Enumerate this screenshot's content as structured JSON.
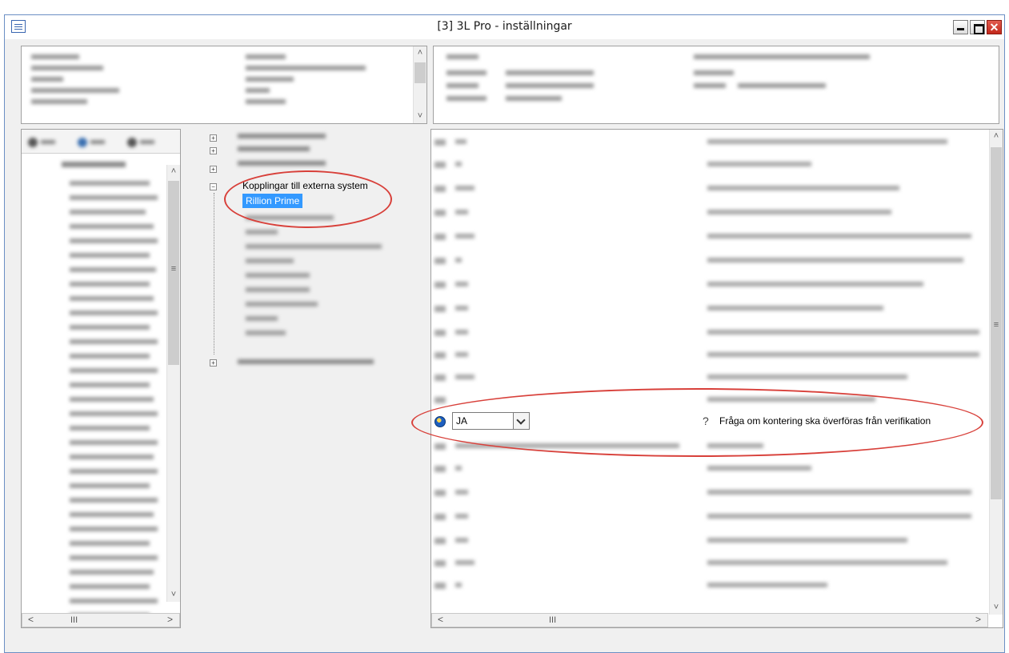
{
  "window": {
    "title": "[3]  3L Pro - inställningar",
    "close_glyph": "✕"
  },
  "middle_tree": {
    "expanded_node": "Kopplingar till externa system",
    "selected_child": "Rillion Prime"
  },
  "settings_grid": {
    "highlighted_row": {
      "value": "JA",
      "label": "Fråga om kontering ska överföras från verifikation"
    }
  },
  "scrollbars": {
    "up_arrow": "˄",
    "down_arrow": "˅",
    "left_arrow": "<",
    "right_arrow": ">",
    "grip_horizontal": "III",
    "grip_vertical": "≡"
  },
  "tree_expanders": {
    "expand": "+",
    "collapse": "−"
  },
  "icons": [
    "window-menu-icon",
    "minimize-icon",
    "maximize-icon",
    "close-icon",
    "globe-icon",
    "question-icon",
    "chevron-down-icon"
  ],
  "colors": {
    "selection": "#3399ff",
    "annotation_ellipse": "#d8403a",
    "close_button": "#c3281b"
  }
}
